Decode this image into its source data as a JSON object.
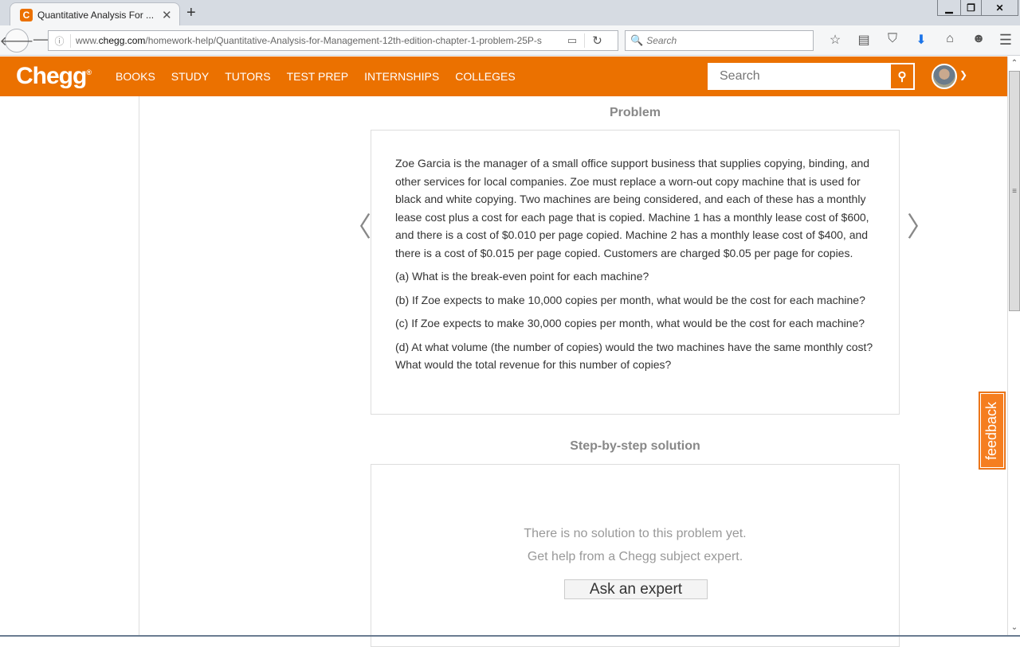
{
  "browser": {
    "tab_title": "Quantitative Analysis For ...",
    "tab_favicon": "C",
    "url_prefix": "www.",
    "url_domain": "chegg.com",
    "url_path": "/homework-help/Quantitative-Analysis-for-Management-12th-edition-chapter-1-problem-25P-s",
    "search_placeholder": "Search",
    "window_controls": {
      "minimize": "▁",
      "restore": "❐",
      "close": "✕"
    }
  },
  "site": {
    "brand_color": "#eb7100",
    "logo": "Chegg",
    "logo_mark": "®",
    "nav": [
      "BOOKS",
      "STUDY",
      "TUTORS",
      "TEST PREP",
      "INTERNSHIPS",
      "COLLEGES"
    ],
    "search_placeholder": "Search"
  },
  "problem": {
    "heading": "Problem",
    "paragraphs": [
      "Zoe Garcia is the manager of a small office support business that supplies copying, binding, and other services for local companies. Zoe must replace a worn-out copy machine that is used for black and white copying. Two machines are being considered, and each of these has a monthly lease cost plus a cost for each page that is copied. Machine 1 has a monthly lease cost of $600, and there is a cost of $0.010 per page copied. Machine 2 has a monthly lease cost of $400, and there is a cost of $0.015 per page copied. Customers are charged $0.05 per page for copies.",
      "(a) What is the break-even point for each machine?",
      "(b) If Zoe expects to make 10,000 copies per month, what would be the cost for each machine?",
      "(c) If Zoe expects to make 30,000 copies per month, what would be the cost for each machine?",
      "(d) At what volume (the number of copies) would the two machines have the same monthly cost? What would the total revenue for this number of copies?"
    ]
  },
  "solution": {
    "heading": "Step-by-step solution",
    "line1": "There is no solution to this problem yet.",
    "line2": "Get help from a Chegg subject expert.",
    "button": "Ask an expert"
  },
  "feedback_label": "feedback"
}
